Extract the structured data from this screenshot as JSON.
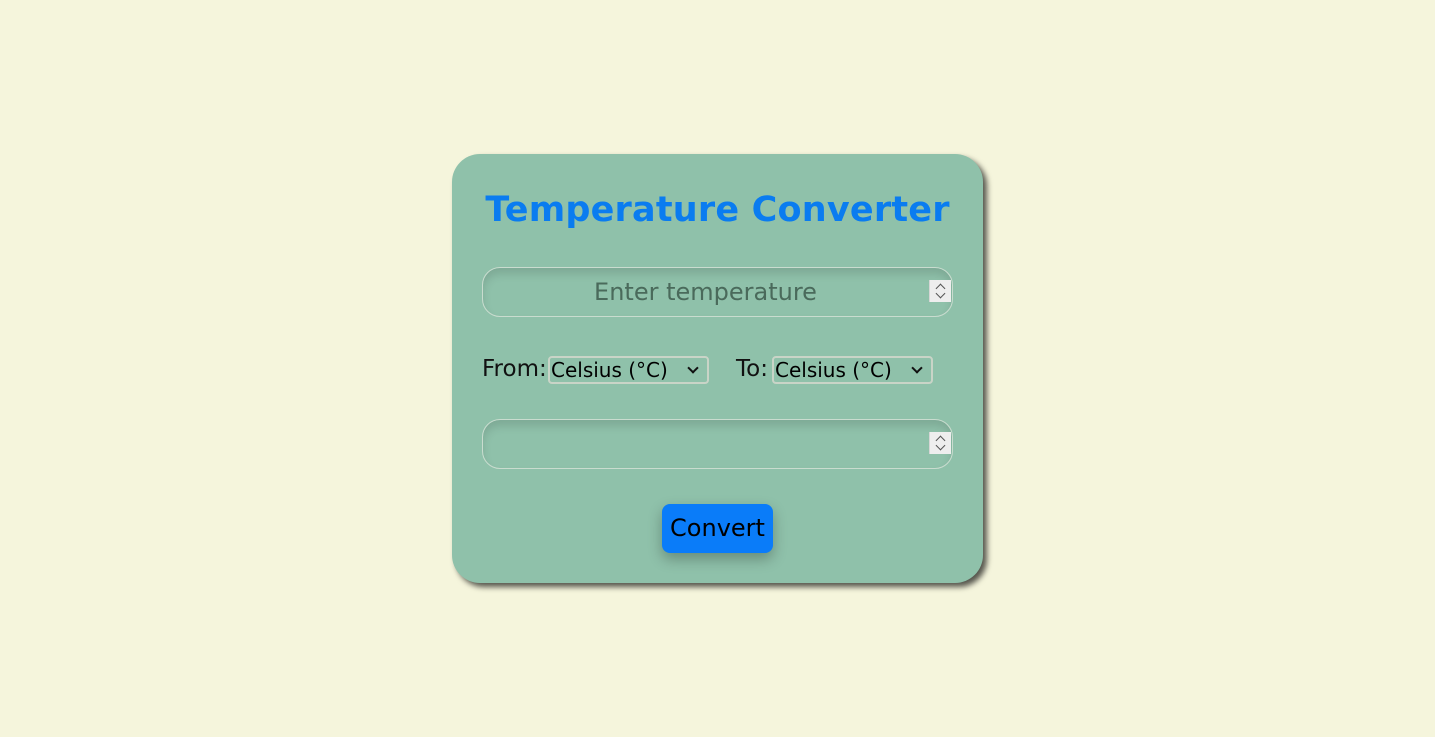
{
  "card": {
    "title": "Temperature Converter",
    "input": {
      "placeholder": "Enter temperature",
      "value": ""
    },
    "result": {
      "value": ""
    },
    "from_label": "From:",
    "to_label": "To:",
    "from_select": {
      "selected": "Celsius (°C)"
    },
    "to_select": {
      "selected": "Celsius (°C)"
    },
    "button_label": "Convert"
  },
  "colors": {
    "background": "#f5f5dc",
    "card": "#8fc1aa",
    "title": "#0a7cf0",
    "button": "#0a7cf9"
  }
}
